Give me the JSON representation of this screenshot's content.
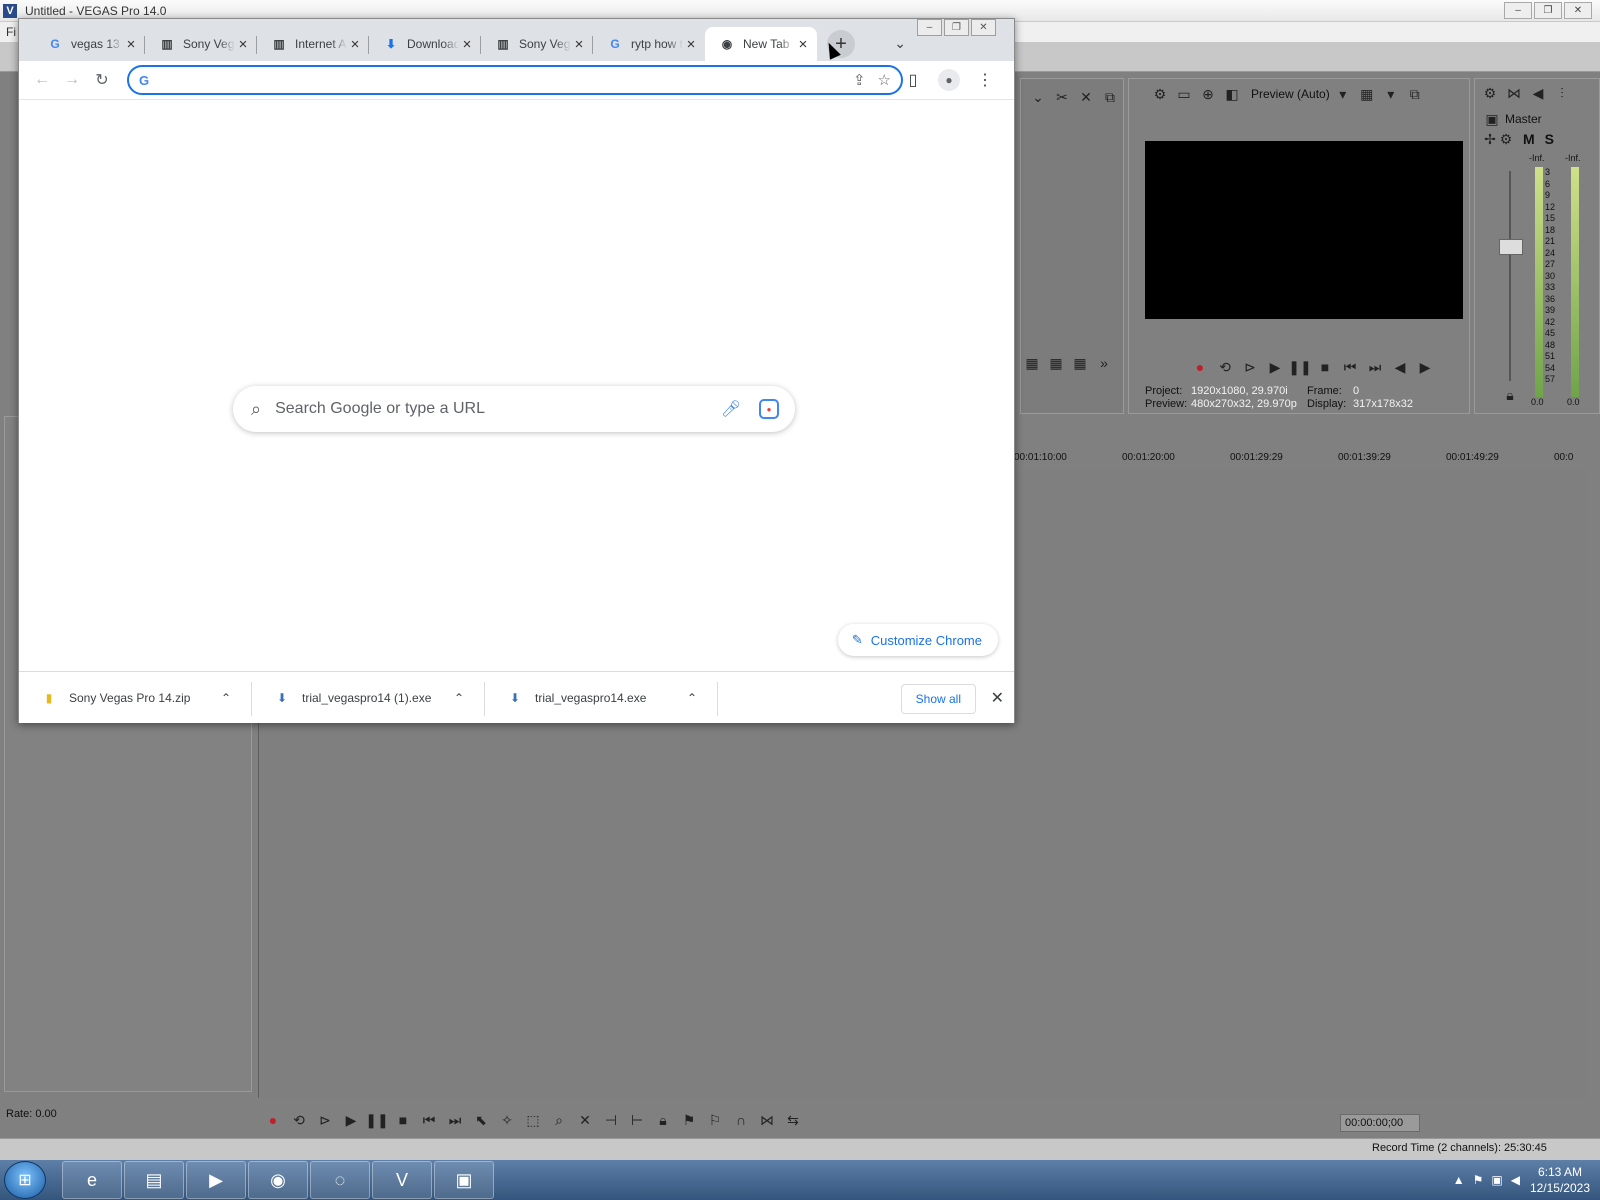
{
  "vegas": {
    "title": "Untitled - VEGAS Pro 14.0",
    "menu_peek": "Fi",
    "preview": {
      "mode_label": "Preview (Auto)",
      "project_label": "Project:",
      "project_value": "1920x1080, 29.970i",
      "preview_label": "Preview:",
      "preview_value": "480x270x32, 29.970p",
      "frame_label": "Frame:",
      "frame_value": "0",
      "display_label": "Display:",
      "display_value": "317x178x32"
    },
    "master": {
      "label": "Master",
      "m_label": "M",
      "s_label": "S",
      "inf_left": "-Inf.",
      "inf_right": "-Inf.",
      "bottom_left": "0.0",
      "bottom_right": "0.0",
      "scale": [
        "3",
        "6",
        "9",
        "12",
        "15",
        "18",
        "21",
        "24",
        "27",
        "30",
        "33",
        "36",
        "39",
        "42",
        "45",
        "48",
        "51",
        "54",
        "57"
      ]
    },
    "timeline": {
      "ruler": [
        "00:01:10:00",
        "00:01:20:00",
        "00:01:29:29",
        "00:01:39:29",
        "00:01:49:29",
        "00:0"
      ]
    },
    "rate": "Rate: 0.00",
    "timecode": "00:00:00;00",
    "record_time": "Record Time (2 channels): 25:30:45"
  },
  "chrome": {
    "tabs": [
      {
        "title": "vegas 13",
        "icon": "google-icon",
        "glyph": "G"
      },
      {
        "title": "Sony Vegas",
        "icon": "site-icon",
        "glyph": "▥"
      },
      {
        "title": "Internet Archive",
        "icon": "site-icon",
        "glyph": "▥"
      },
      {
        "title": "Downloads",
        "icon": "download-icon",
        "glyph": "⬇"
      },
      {
        "title": "Sony Vegas",
        "icon": "site-icon",
        "glyph": "▥"
      },
      {
        "title": "rytp how to",
        "icon": "google-icon",
        "glyph": "G"
      },
      {
        "title": "New Tab",
        "icon": "chrome-icon",
        "glyph": "◉"
      }
    ],
    "omnibox": {
      "value": "",
      "g_glyph": "G"
    },
    "ntp": {
      "search_placeholder": "Search Google or type a URL",
      "customize_label": "Customize Chrome"
    },
    "downloads": [
      {
        "name": "Sony Vegas Pro 14.zip",
        "glyph": "▮",
        "color": "#e6b91e"
      },
      {
        "name": "trial_vegaspro14 (1).exe",
        "glyph": "⬇",
        "color": "#3b6fb6"
      },
      {
        "name": "trial_vegaspro14.exe",
        "glyph": "⬇",
        "color": "#3b6fb6"
      }
    ],
    "show_all_label": "Show all"
  },
  "taskbar": {
    "time": "6:13 AM",
    "date": "12/15/2023",
    "apps": [
      "Internet Explorer",
      "File Explorer",
      "Media Player",
      "Google Chrome",
      "Microsoft Edge",
      "VEGAS Pro",
      "Remote Desktop"
    ]
  },
  "colors": {
    "accent_blue": "#1a73e8",
    "vegas_gray": "#808080",
    "tabstrip": "#dee1e6"
  }
}
